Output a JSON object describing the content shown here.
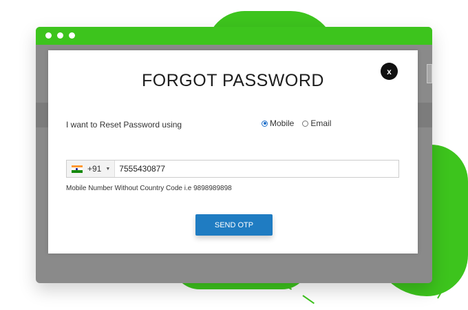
{
  "modal": {
    "title": "FORGOT PASSWORD",
    "close_label": "x",
    "reset_label": "I want to Reset Password using",
    "options": [
      {
        "label": "Mobile",
        "checked": true
      },
      {
        "label": "Email",
        "checked": false
      }
    ],
    "phone": {
      "country_flag": "india-flag-icon",
      "dial_code": "+91",
      "value": "7555430877"
    },
    "hint": "Mobile Number Without Country Code i.e 9898989898",
    "send_label": "SEND OTP"
  },
  "colors": {
    "accent_green": "#3dc41d",
    "button_blue": "#1f7cc2",
    "radio_blue": "#1f6fc9"
  }
}
